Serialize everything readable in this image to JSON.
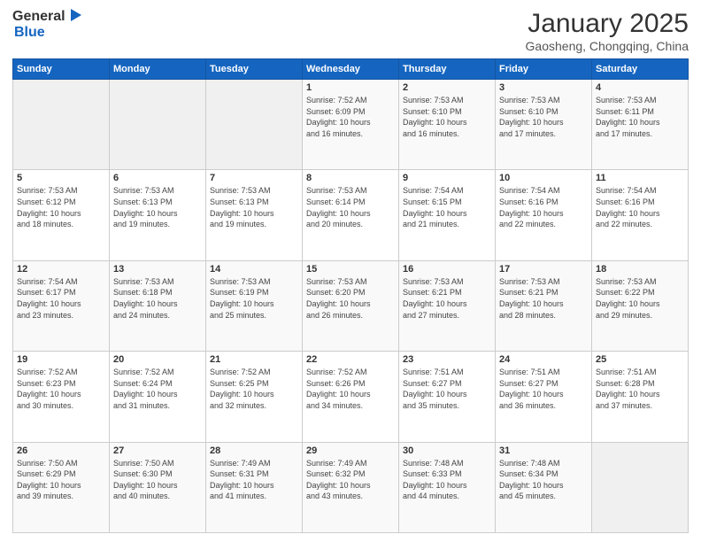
{
  "header": {
    "logo_general": "General",
    "logo_blue": "Blue",
    "title": "January 2025",
    "subtitle": "Gaosheng, Chongqing, China"
  },
  "weekdays": [
    "Sunday",
    "Monday",
    "Tuesday",
    "Wednesday",
    "Thursday",
    "Friday",
    "Saturday"
  ],
  "weeks": [
    {
      "days": [
        {
          "num": "",
          "info": "",
          "empty": true
        },
        {
          "num": "",
          "info": "",
          "empty": true
        },
        {
          "num": "",
          "info": "",
          "empty": true
        },
        {
          "num": "1",
          "info": "Sunrise: 7:52 AM\nSunset: 6:09 PM\nDaylight: 10 hours\nand 16 minutes."
        },
        {
          "num": "2",
          "info": "Sunrise: 7:53 AM\nSunset: 6:10 PM\nDaylight: 10 hours\nand 16 minutes."
        },
        {
          "num": "3",
          "info": "Sunrise: 7:53 AM\nSunset: 6:10 PM\nDaylight: 10 hours\nand 17 minutes."
        },
        {
          "num": "4",
          "info": "Sunrise: 7:53 AM\nSunset: 6:11 PM\nDaylight: 10 hours\nand 17 minutes."
        }
      ]
    },
    {
      "days": [
        {
          "num": "5",
          "info": "Sunrise: 7:53 AM\nSunset: 6:12 PM\nDaylight: 10 hours\nand 18 minutes."
        },
        {
          "num": "6",
          "info": "Sunrise: 7:53 AM\nSunset: 6:13 PM\nDaylight: 10 hours\nand 19 minutes."
        },
        {
          "num": "7",
          "info": "Sunrise: 7:53 AM\nSunset: 6:13 PM\nDaylight: 10 hours\nand 19 minutes."
        },
        {
          "num": "8",
          "info": "Sunrise: 7:53 AM\nSunset: 6:14 PM\nDaylight: 10 hours\nand 20 minutes."
        },
        {
          "num": "9",
          "info": "Sunrise: 7:54 AM\nSunset: 6:15 PM\nDaylight: 10 hours\nand 21 minutes."
        },
        {
          "num": "10",
          "info": "Sunrise: 7:54 AM\nSunset: 6:16 PM\nDaylight: 10 hours\nand 22 minutes."
        },
        {
          "num": "11",
          "info": "Sunrise: 7:54 AM\nSunset: 6:16 PM\nDaylight: 10 hours\nand 22 minutes."
        }
      ]
    },
    {
      "days": [
        {
          "num": "12",
          "info": "Sunrise: 7:54 AM\nSunset: 6:17 PM\nDaylight: 10 hours\nand 23 minutes."
        },
        {
          "num": "13",
          "info": "Sunrise: 7:53 AM\nSunset: 6:18 PM\nDaylight: 10 hours\nand 24 minutes."
        },
        {
          "num": "14",
          "info": "Sunrise: 7:53 AM\nSunset: 6:19 PM\nDaylight: 10 hours\nand 25 minutes."
        },
        {
          "num": "15",
          "info": "Sunrise: 7:53 AM\nSunset: 6:20 PM\nDaylight: 10 hours\nand 26 minutes."
        },
        {
          "num": "16",
          "info": "Sunrise: 7:53 AM\nSunset: 6:21 PM\nDaylight: 10 hours\nand 27 minutes."
        },
        {
          "num": "17",
          "info": "Sunrise: 7:53 AM\nSunset: 6:21 PM\nDaylight: 10 hours\nand 28 minutes."
        },
        {
          "num": "18",
          "info": "Sunrise: 7:53 AM\nSunset: 6:22 PM\nDaylight: 10 hours\nand 29 minutes."
        }
      ]
    },
    {
      "days": [
        {
          "num": "19",
          "info": "Sunrise: 7:52 AM\nSunset: 6:23 PM\nDaylight: 10 hours\nand 30 minutes."
        },
        {
          "num": "20",
          "info": "Sunrise: 7:52 AM\nSunset: 6:24 PM\nDaylight: 10 hours\nand 31 minutes."
        },
        {
          "num": "21",
          "info": "Sunrise: 7:52 AM\nSunset: 6:25 PM\nDaylight: 10 hours\nand 32 minutes."
        },
        {
          "num": "22",
          "info": "Sunrise: 7:52 AM\nSunset: 6:26 PM\nDaylight: 10 hours\nand 34 minutes."
        },
        {
          "num": "23",
          "info": "Sunrise: 7:51 AM\nSunset: 6:27 PM\nDaylight: 10 hours\nand 35 minutes."
        },
        {
          "num": "24",
          "info": "Sunrise: 7:51 AM\nSunset: 6:27 PM\nDaylight: 10 hours\nand 36 minutes."
        },
        {
          "num": "25",
          "info": "Sunrise: 7:51 AM\nSunset: 6:28 PM\nDaylight: 10 hours\nand 37 minutes."
        }
      ]
    },
    {
      "days": [
        {
          "num": "26",
          "info": "Sunrise: 7:50 AM\nSunset: 6:29 PM\nDaylight: 10 hours\nand 39 minutes."
        },
        {
          "num": "27",
          "info": "Sunrise: 7:50 AM\nSunset: 6:30 PM\nDaylight: 10 hours\nand 40 minutes."
        },
        {
          "num": "28",
          "info": "Sunrise: 7:49 AM\nSunset: 6:31 PM\nDaylight: 10 hours\nand 41 minutes."
        },
        {
          "num": "29",
          "info": "Sunrise: 7:49 AM\nSunset: 6:32 PM\nDaylight: 10 hours\nand 43 minutes."
        },
        {
          "num": "30",
          "info": "Sunrise: 7:48 AM\nSunset: 6:33 PM\nDaylight: 10 hours\nand 44 minutes."
        },
        {
          "num": "31",
          "info": "Sunrise: 7:48 AM\nSunset: 6:34 PM\nDaylight: 10 hours\nand 45 minutes."
        },
        {
          "num": "",
          "info": "",
          "empty": true
        }
      ]
    }
  ]
}
